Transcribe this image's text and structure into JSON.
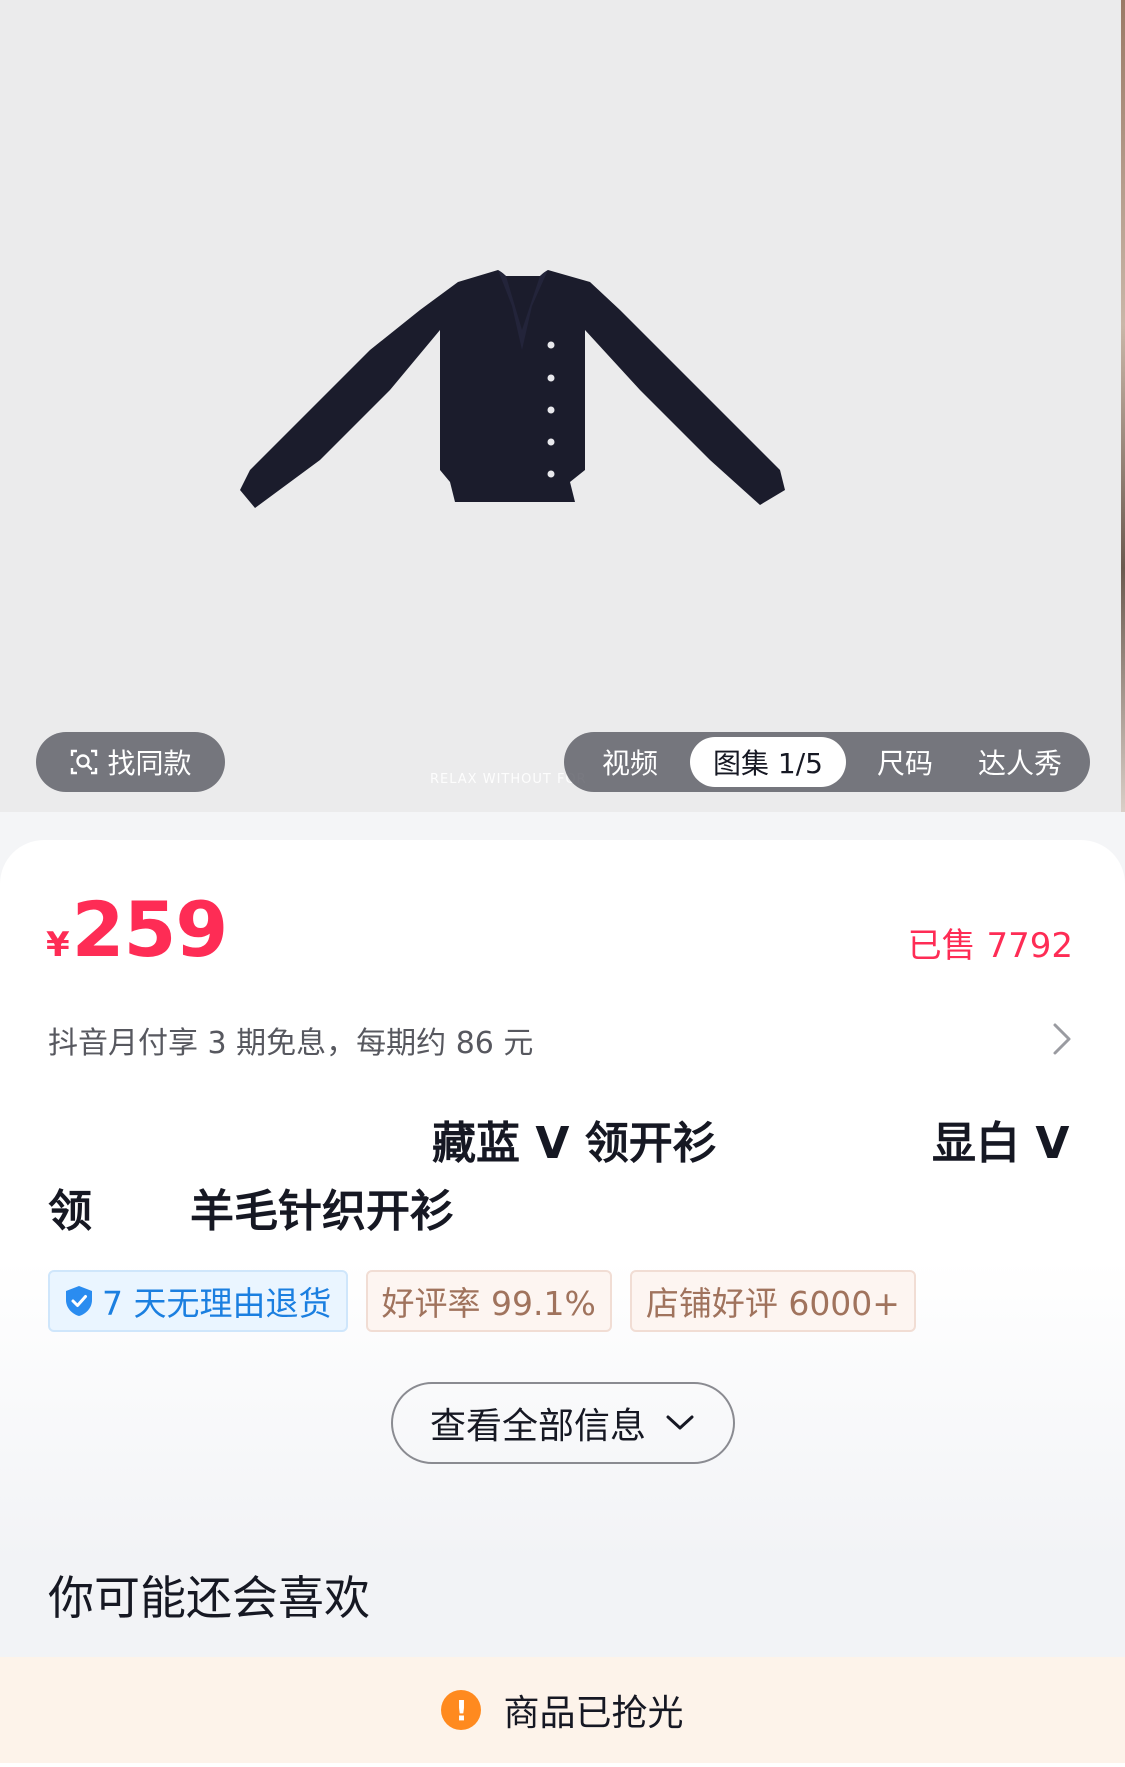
{
  "hero": {
    "watermark": "RELAX WITHOUT FOR",
    "find_same_label": "找同款",
    "media_tabs": [
      {
        "label": "视频"
      },
      {
        "label": "图集 1/5",
        "active": true
      },
      {
        "label": "尺码"
      },
      {
        "label": "达人秀"
      }
    ]
  },
  "price": {
    "currency": "¥",
    "amount": "259",
    "sold": "已售 7792",
    "color": "#fe2c55"
  },
  "installment": {
    "text": "抖音月付享 3 期免息，每期约 86 元"
  },
  "title": {
    "line1_part1": "藏蓝 V 领开衫",
    "line1_part2": "显白 V",
    "line2_part1": "领",
    "line2_part2": "羊毛针织开衫"
  },
  "tags": {
    "return_policy": "7 天无理由退货",
    "good_rate": "好评率 99.1%",
    "store_reviews": "店铺好评 6000+"
  },
  "view_all_label": "查看全部信息",
  "recommend_title": "你可能还会喜欢",
  "soldout": {
    "icon_text": "!",
    "text": "商品已抢光"
  }
}
